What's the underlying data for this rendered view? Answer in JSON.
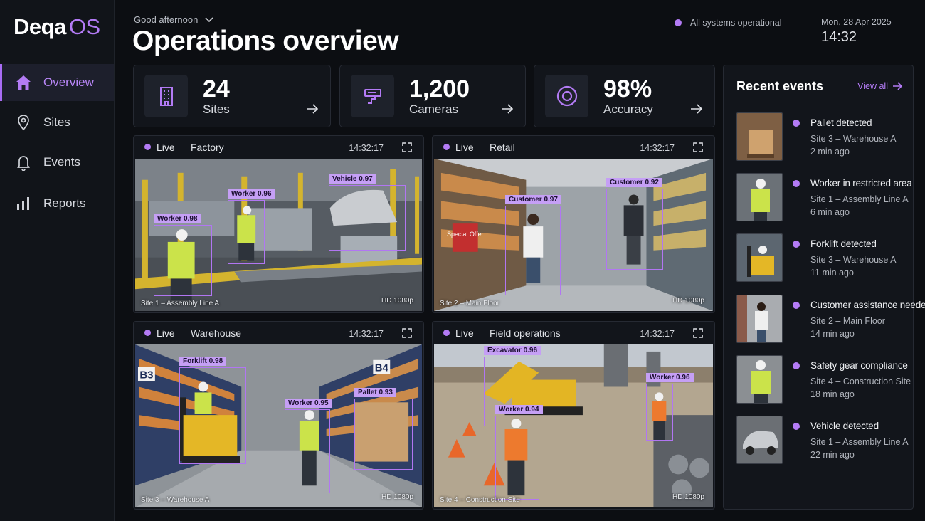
{
  "app": {
    "logo_main": "Deqa",
    "logo_suffix": "OS"
  },
  "sidebar": {
    "items": [
      {
        "label": "Overview",
        "icon": "home-icon",
        "active": true
      },
      {
        "label": "Sites",
        "icon": "location-pin-icon"
      },
      {
        "label": "Events",
        "icon": "bell-icon"
      },
      {
        "label": "Reports",
        "icon": "bar-chart-icon"
      }
    ]
  },
  "header": {
    "greeting": "Good afternoon",
    "title": "Operations overview",
    "status": "All systems operational",
    "date": "Mon, 28 Apr 2025",
    "time": "14:32"
  },
  "stats": [
    {
      "value": "24",
      "label": "Sites",
      "icon": "building-icon"
    },
    {
      "value": "1,200",
      "label": "Cameras",
      "icon": "camera-icon"
    },
    {
      "value": "98%",
      "label": "Accuracy",
      "icon": "target-icon"
    }
  ],
  "cameras": [
    {
      "live": "Live",
      "name": "Factory",
      "timestamp": "14:32:17",
      "caption": "Site 1 – Assembly Line A",
      "quality": "HD 1080p",
      "detections": [
        "Worker 0.98",
        "Worker 0.96",
        "Vehicle 0.97"
      ]
    },
    {
      "live": "Live",
      "name": "Retail",
      "timestamp": "14:32:17",
      "caption": "Site 2 – Main Floor",
      "quality": "HD 1080p",
      "detections": [
        "Customer 0.97",
        "Customer 0.92"
      ],
      "sign": "Special Offer"
    },
    {
      "live": "Live",
      "name": "Warehouse",
      "timestamp": "14:32:17",
      "caption": "Site 3 – Warehouse A",
      "quality": "HD 1080p",
      "detections": [
        "Forklift 0.98",
        "Worker 0.95",
        "Pallet 0.93"
      ],
      "aisle_left": "B3",
      "aisle_right": "B4"
    },
    {
      "live": "Live",
      "name": "Field operations",
      "timestamp": "14:32:17",
      "caption": "Site 4 – Construction Site",
      "quality": "HD 1080p",
      "detections": [
        "Excavator 0.96",
        "Worker 0.94",
        "Worker 0.96"
      ]
    }
  ],
  "events": {
    "title": "Recent events",
    "view_all": "View all",
    "items": [
      {
        "title": "Pallet detected",
        "site": "Site 3 – Warehouse A",
        "ago": "2 min ago"
      },
      {
        "title": "Worker in restricted area",
        "site": "Site 1 – Assembly Line A",
        "ago": "6 min ago"
      },
      {
        "title": "Forklift detected",
        "site": "Site 3 – Warehouse A",
        "ago": "11 min ago"
      },
      {
        "title": "Customer assistance needed",
        "site": "Site 2 – Main Floor",
        "ago": "14 min ago"
      },
      {
        "title": "Safety gear compliance",
        "site": "Site 4 – Construction Site",
        "ago": "18 min ago"
      },
      {
        "title": "Vehicle detected",
        "site": "Site 1 – Assembly Line A",
        "ago": "22 min ago"
      }
    ]
  },
  "colors": {
    "accent": "#b37bf5",
    "background": "#0c0e12",
    "panel": "#12151b"
  }
}
